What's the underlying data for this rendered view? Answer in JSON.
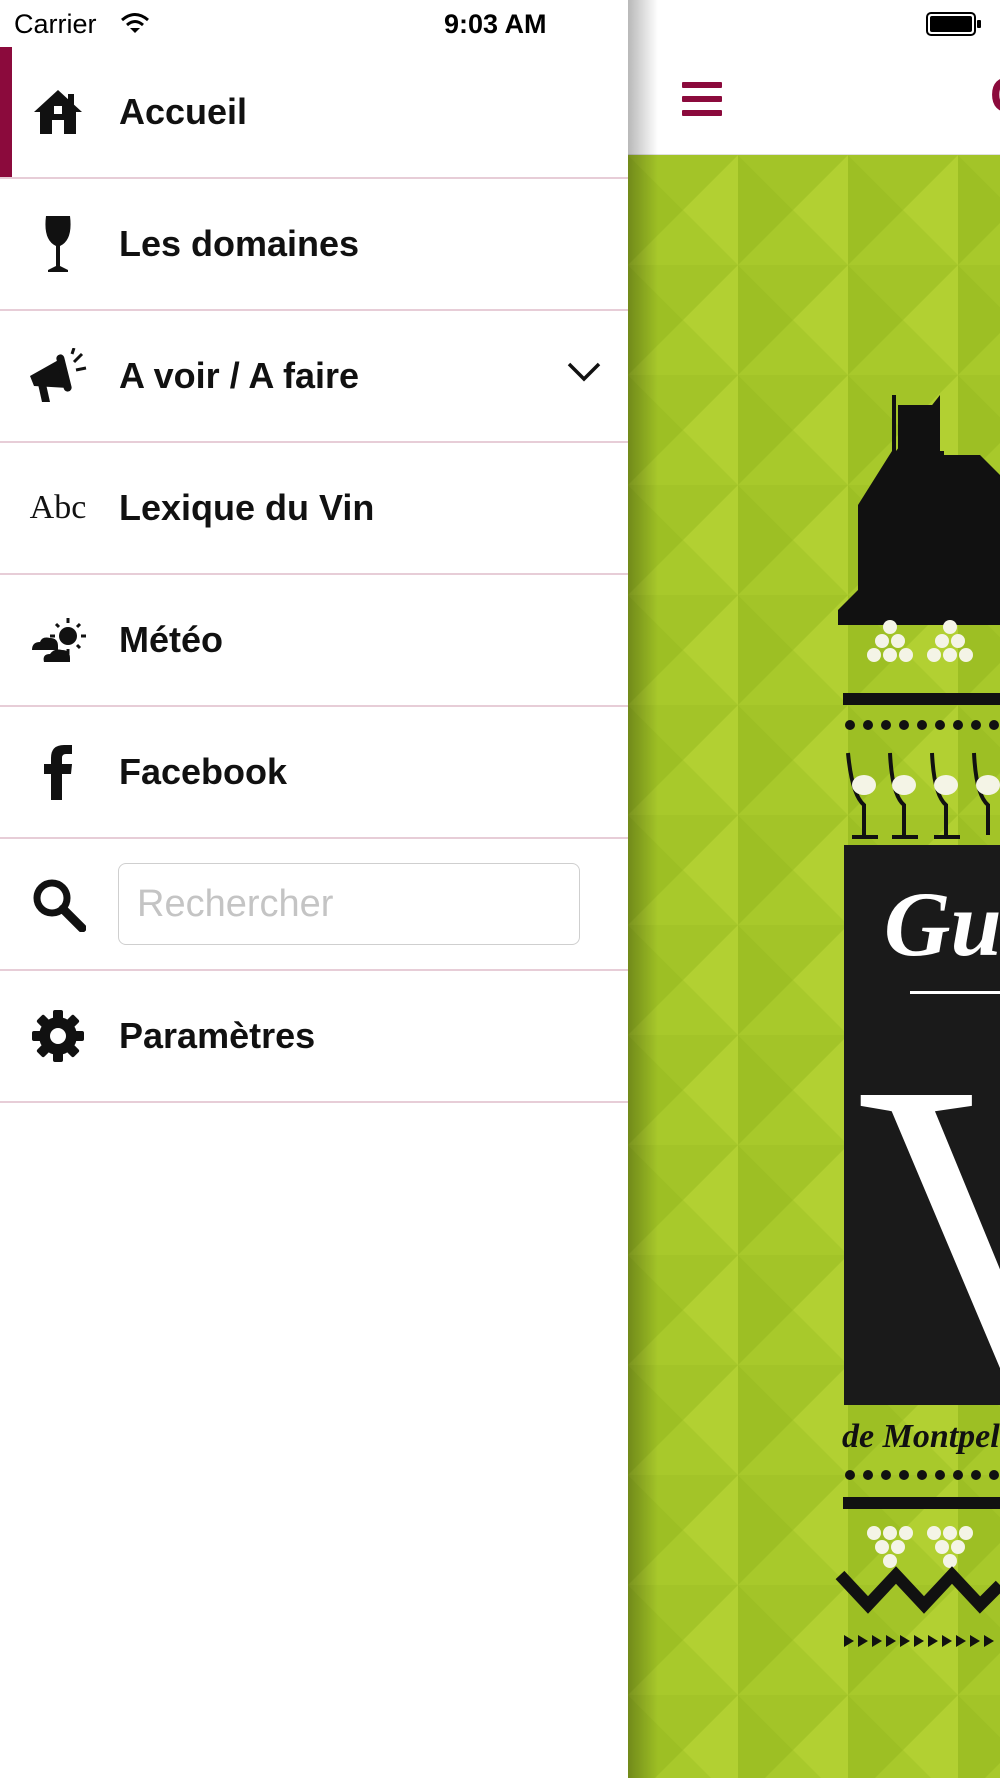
{
  "status_bar": {
    "carrier": "Carrier",
    "time": "9:03 AM"
  },
  "colors": {
    "accent": "#8b0a3c",
    "divider": "#e7cdd7",
    "poster_green": "#a8c92b",
    "poster_dark": "#1a1a1a"
  },
  "menu": {
    "items": [
      {
        "label": "Accueil",
        "icon": "home-icon",
        "active": true
      },
      {
        "label": "Les domaines",
        "icon": "wine-glass-icon"
      },
      {
        "label": "A voir / A faire",
        "icon": "megaphone-icon",
        "expandable": true
      },
      {
        "label": "Lexique du Vin",
        "icon": "abc-icon",
        "icon_text": "Abc"
      },
      {
        "label": "Météo",
        "icon": "weather-icon"
      },
      {
        "label": "Facebook",
        "icon": "facebook-icon"
      },
      {
        "label": "Paramètres",
        "icon": "gear-icon"
      }
    ],
    "search": {
      "placeholder": "Rechercher",
      "value": "",
      "icon": "search-icon"
    }
  },
  "content": {
    "title_fragment": "G",
    "menu_icon": "hamburger-icon",
    "poster": {
      "script_text": "Gu",
      "big_letter": "V",
      "subtitle": "de Montpel"
    }
  }
}
